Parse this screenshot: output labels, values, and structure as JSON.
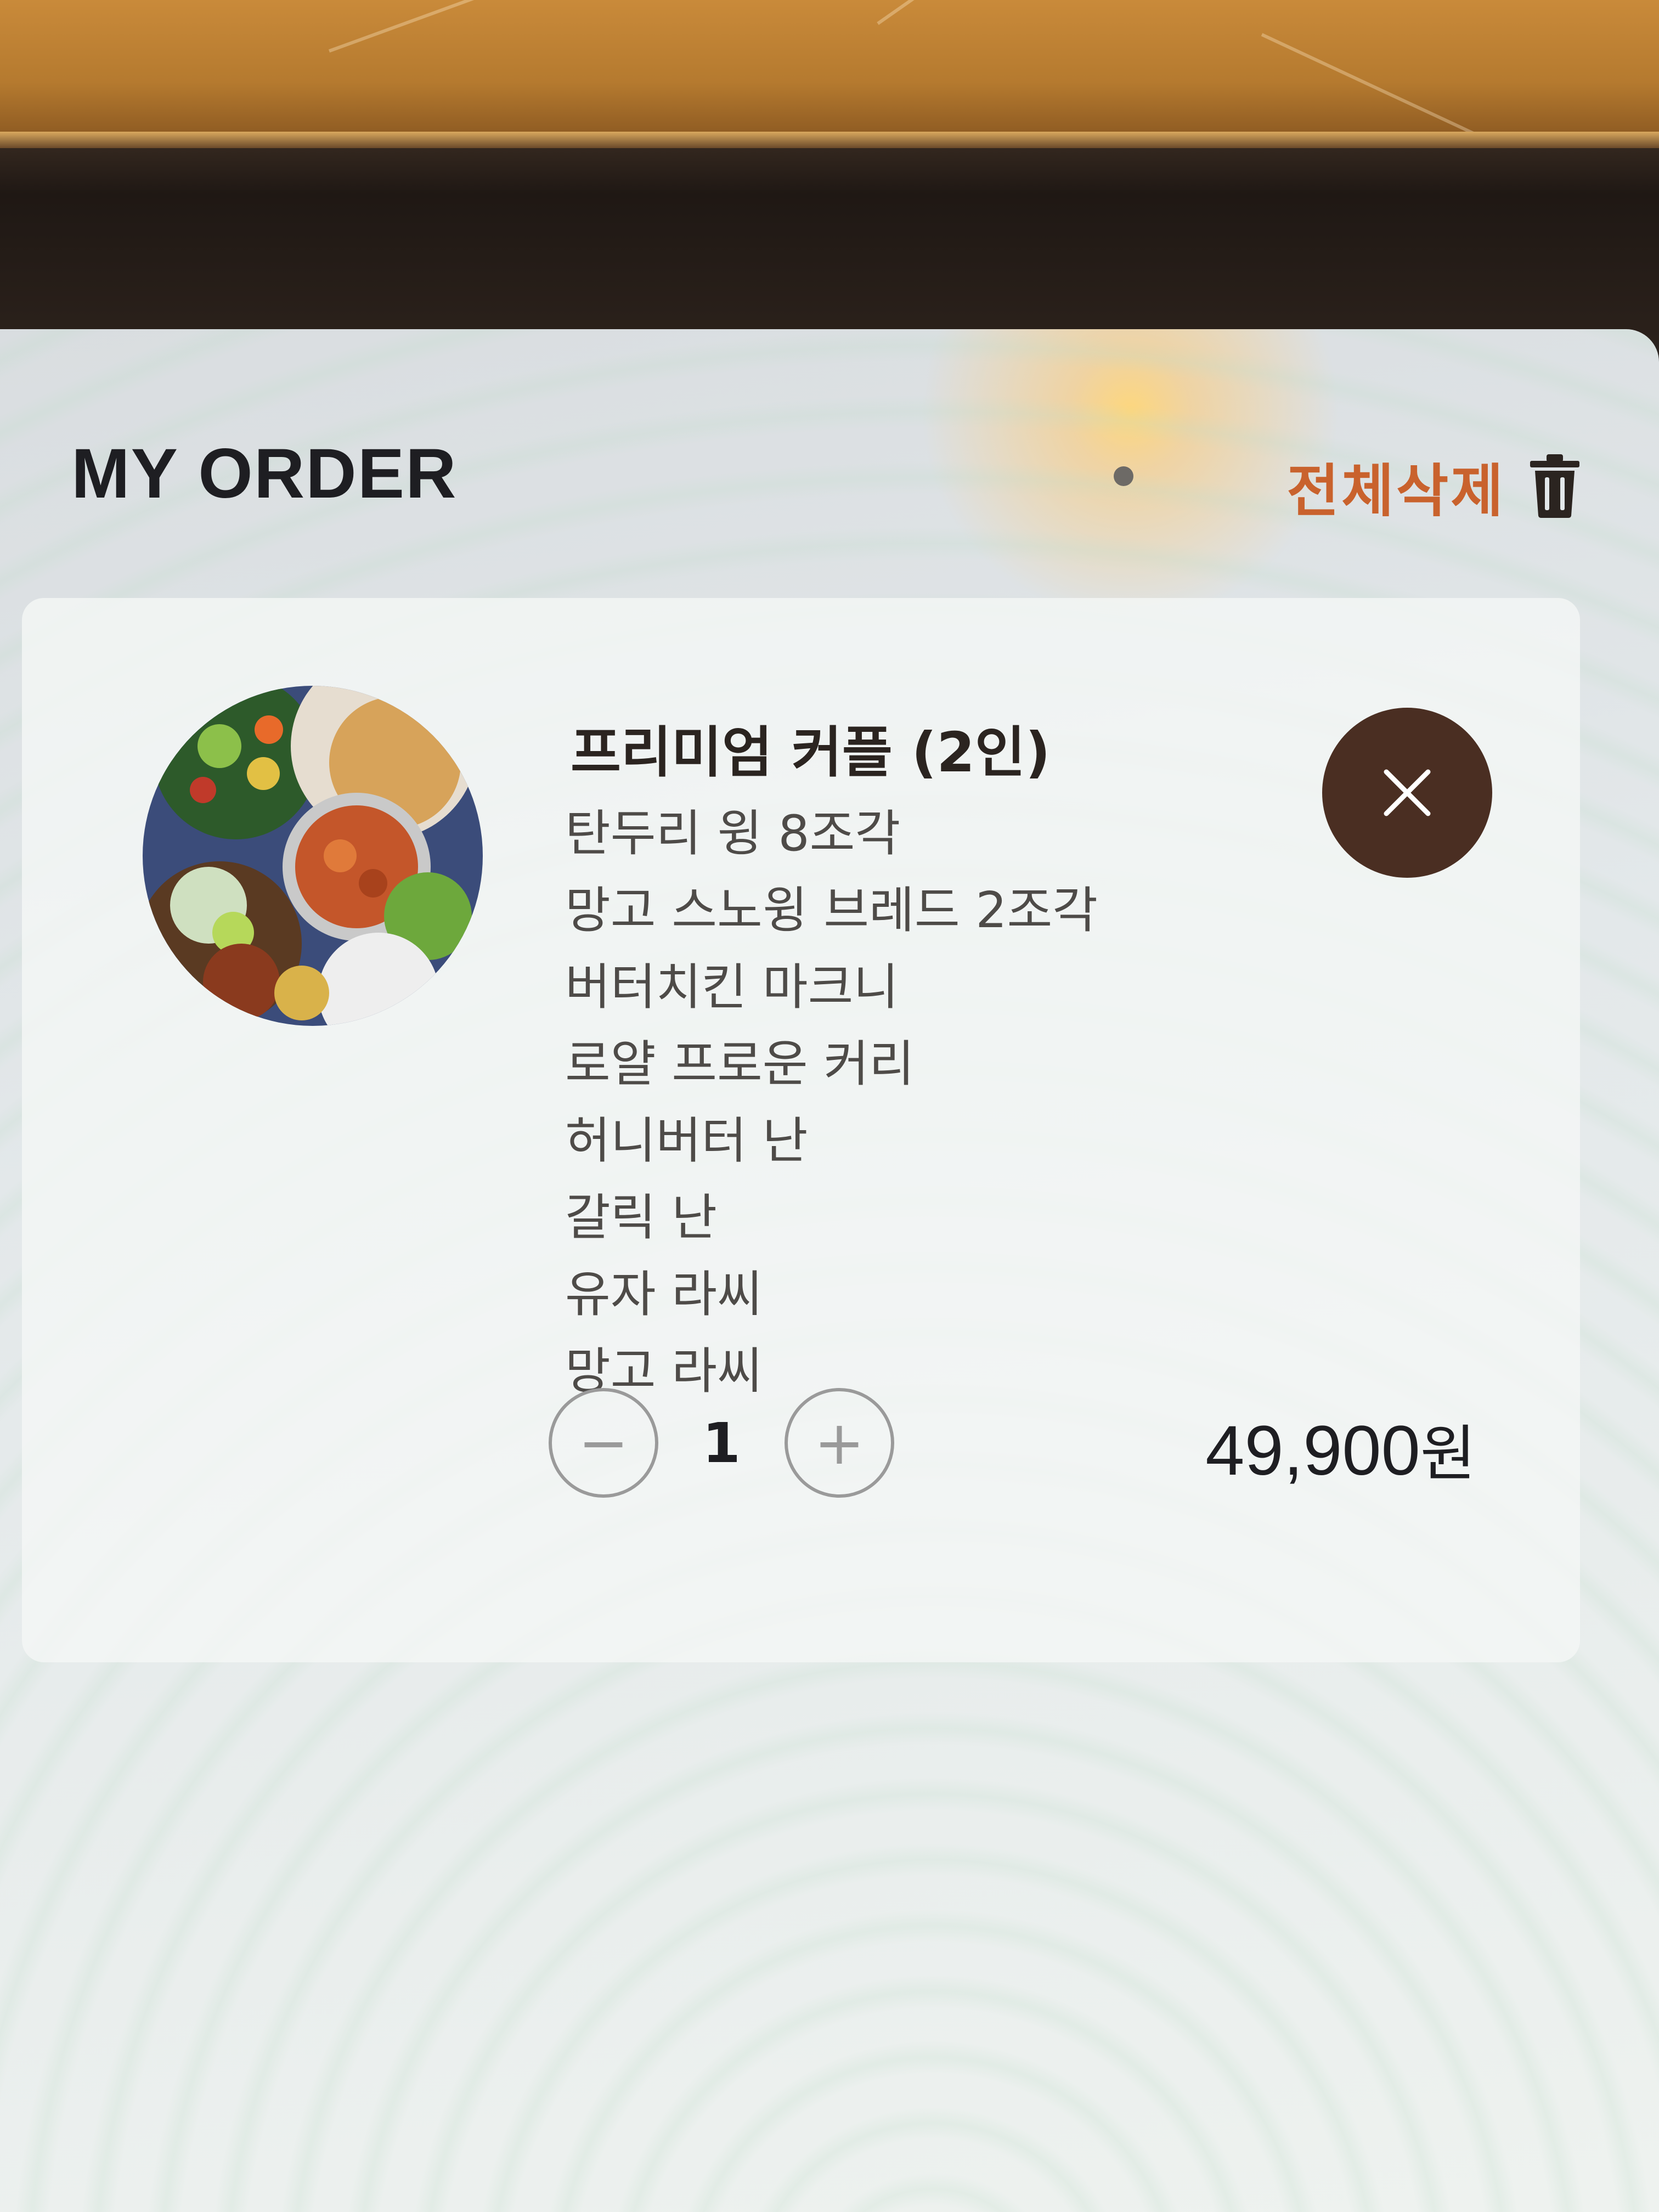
{
  "header": {
    "title": "MY ORDER",
    "clear_all_label": "전체삭제"
  },
  "order_item": {
    "name": "프리미엄 커플 (2인)",
    "components": [
      "탄두리 윙 8조각",
      "망고 스노윙 브레드 2조각",
      "버터치킨 마크니",
      "로얄 프로운 커리",
      "허니버터 난",
      "갈릭 난",
      "유자 라씨",
      "망고 라씨"
    ],
    "quantity": "1",
    "decrement_symbol": "−",
    "increment_symbol": "+",
    "price_amount": "49,900",
    "price_unit": "원"
  },
  "colors": {
    "accent": "#c9622d",
    "remove_button": "#4a2e22",
    "text": "#1e1e22"
  },
  "icons": [
    "trash-icon",
    "close-icon",
    "minus-icon",
    "plus-icon"
  ]
}
